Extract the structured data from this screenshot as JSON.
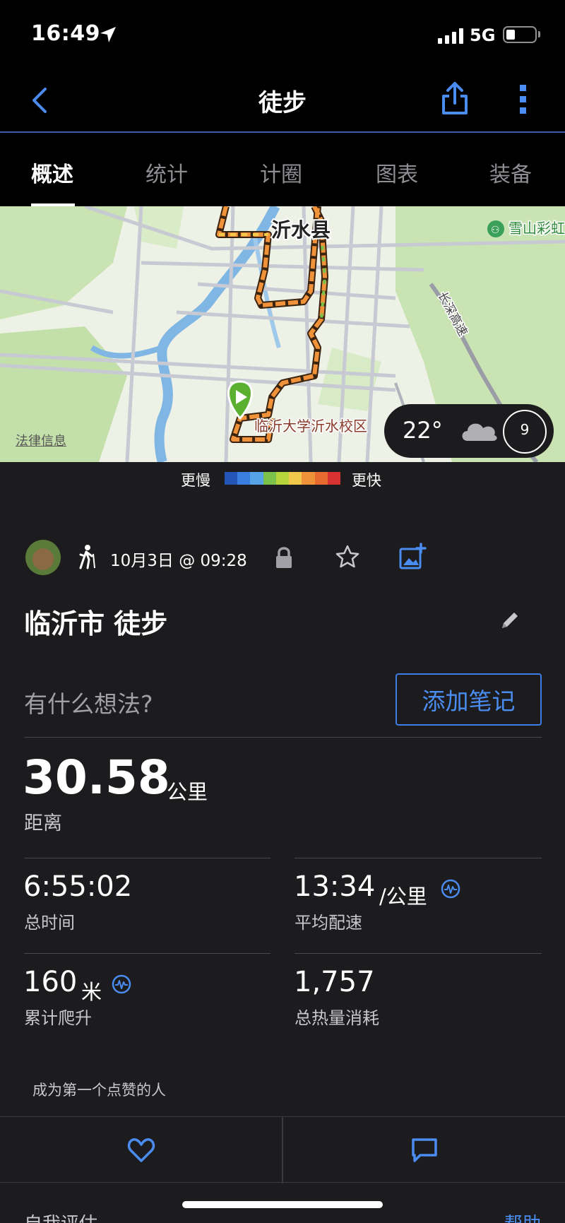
{
  "status_bar": {
    "time": "16:49",
    "network": "5G"
  },
  "nav": {
    "title": "徒步"
  },
  "tabs": [
    "概述",
    "统计",
    "计圈",
    "图表",
    "装备"
  ],
  "map": {
    "city_label": "沂水县",
    "poi_label": "临沂大学沂水校区",
    "poi_right": "雪山彩虹",
    "road_label": "长深高速",
    "legal": "法律信息"
  },
  "weather": {
    "temp": "22°",
    "wind": "9"
  },
  "speed_legend": {
    "slow": "更慢",
    "fast": "更快",
    "colors": [
      "#2456b8",
      "#3a7ee0",
      "#57a3e8",
      "#7cc24a",
      "#b8d43c",
      "#f2c84b",
      "#f0923a",
      "#e86a2e",
      "#d93232"
    ]
  },
  "activity": {
    "date": "10月3日 @ 09:28",
    "title": "临沂市 徒步",
    "thoughts_placeholder": "有什么想法?",
    "add_note": "添加笔记"
  },
  "stats": {
    "distance": {
      "value": "30.58",
      "unit": "公里",
      "label": "距离"
    },
    "total_time": {
      "value": "6:55:02",
      "label": "总时间"
    },
    "avg_pace": {
      "value": "13:34",
      "unit": "/公里",
      "label": "平均配速"
    },
    "elevation": {
      "value": "160",
      "unit": "米",
      "label": "累计爬升"
    },
    "calories": {
      "value": "1,757",
      "label": "总热量消耗"
    }
  },
  "social": {
    "likes_text": "成为第一个点赞的人"
  },
  "footer": {
    "self_eval": "自我评估",
    "help": "帮助"
  },
  "colors": {
    "accent": "#4a8cf0",
    "background": "#1c1c1e"
  }
}
